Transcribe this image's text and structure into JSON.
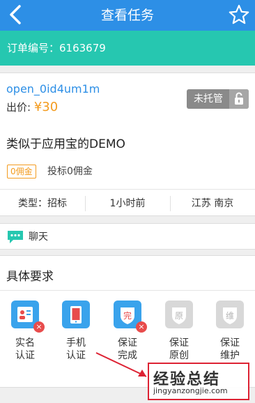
{
  "nav": {
    "title": "查看任务",
    "back_icon": "back-icon",
    "star_icon": "star-icon"
  },
  "order": {
    "label": "订单编号：6163679"
  },
  "task": {
    "user": "open_0id4um1m",
    "price_label": "出价: ",
    "price_value": "¥30",
    "trust_label": "未托管",
    "title": "类似于应用宝的DEMO",
    "commission_badge": "0佣金",
    "commission_text": "投标0佣金",
    "type": "类型：招标",
    "time": "1小时前",
    "location": "江苏 南京"
  },
  "chat": {
    "label": "聊天"
  },
  "requirements": {
    "title": "具体要求",
    "items": [
      {
        "label1": "实名",
        "label2": "认证",
        "icon_text": "",
        "active": true,
        "mark": "×"
      },
      {
        "label1": "手机",
        "label2": "认证",
        "icon_text": "",
        "active": true,
        "mark": ""
      },
      {
        "label1": "保证",
        "label2": "完成",
        "icon_text": "完",
        "active": true,
        "mark": "×"
      },
      {
        "label1": "保证",
        "label2": "原创",
        "icon_text": "原",
        "active": false,
        "mark": ""
      },
      {
        "label1": "保证",
        "label2": "维护",
        "icon_text": "维",
        "active": false,
        "mark": ""
      }
    ]
  },
  "watermark": {
    "main": "经验总结",
    "sub": "jingyanzongjie.com"
  },
  "colors": {
    "nav": "#2d8fe6",
    "order_bar": "#26c7b0",
    "price": "#f39b1e",
    "link": "#2d8fe6"
  }
}
